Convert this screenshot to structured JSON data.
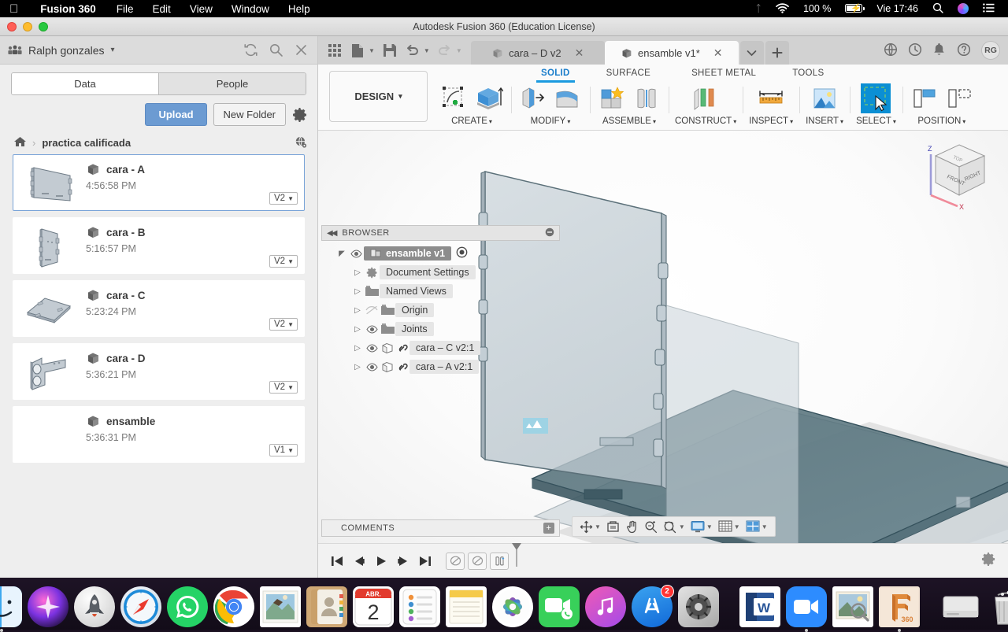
{
  "macos": {
    "apple_icon": "apple-logo-icon",
    "app_name": "Fusion 360",
    "menus": [
      "File",
      "Edit",
      "View",
      "Window",
      "Help"
    ],
    "status": {
      "bluetooth_icon": "bluetooth-icon",
      "wifi_icon": "wifi-icon",
      "battery_percent": "100 %",
      "battery_icon": "battery-charging-icon",
      "clock": "Vie 17:46",
      "search_icon": "spotlight-search-icon",
      "siri_icon": "siri-icon",
      "control_center_icon": "notification-center-icon"
    }
  },
  "window": {
    "title": "Autodesk Fusion 360 (Education License)"
  },
  "data_panel": {
    "user_name": "Ralph gonzales",
    "user_caret": "▾",
    "icons": {
      "people_group": "people-group-icon",
      "refresh": "refresh-icon",
      "search": "search-icon",
      "close": "close-icon",
      "settings_gear": "gear-icon",
      "globe": "globe-share-icon",
      "home": "home-icon"
    },
    "tabs": [
      {
        "label": "Data",
        "active": true
      },
      {
        "label": "People",
        "active": false
      }
    ],
    "upload_label": "Upload",
    "new_folder_label": "New Folder",
    "breadcrumb": {
      "home": "home-icon",
      "separator": "›",
      "folder": "practica calificada"
    },
    "files": [
      {
        "name": "cara - A",
        "time": "4:56:58 PM",
        "version": "V2",
        "selected": true,
        "thumb": "panel-a"
      },
      {
        "name": "cara - B",
        "time": "5:16:57 PM",
        "version": "V2",
        "selected": false,
        "thumb": "panel-b"
      },
      {
        "name": "cara - C",
        "time": "5:23:24 PM",
        "version": "V2",
        "selected": false,
        "thumb": "panel-c"
      },
      {
        "name": "cara - D",
        "time": "5:36:21 PM",
        "version": "V2",
        "selected": false,
        "thumb": "panel-d"
      },
      {
        "name": "ensamble",
        "time": "5:36:31 PM",
        "version": "V1",
        "selected": false,
        "thumb": "none"
      }
    ]
  },
  "quick_access": {
    "icons": [
      "grid-apps-icon",
      "new-file-icon",
      "save-icon",
      "undo-icon",
      "redo-icon"
    ]
  },
  "document_tabs": [
    {
      "label": "cara – D v2",
      "active": false,
      "close": "✕"
    },
    {
      "label": "ensamble v1*",
      "active": true,
      "close": "✕"
    }
  ],
  "tab_buttons": {
    "dropdown": "chevron-down-icon",
    "add": "+"
  },
  "header_right": {
    "icons": [
      "globe-icon",
      "job-status-icon",
      "notifications-bell-icon",
      "help-question-icon"
    ],
    "avatar_initials": "RG"
  },
  "ribbon": {
    "workspace": "DESIGN",
    "workspace_caret": "▾",
    "tabs": [
      {
        "label": "SOLID",
        "active": true
      },
      {
        "label": "SURFACE",
        "active": false
      },
      {
        "label": "SHEET METAL",
        "active": false
      },
      {
        "label": "TOOLS",
        "active": false
      }
    ],
    "panels": [
      {
        "label": "CREATE",
        "caret": "▾",
        "icons": [
          "create-sketch-icon",
          "extrude-icon"
        ]
      },
      {
        "label": "MODIFY",
        "caret": "▾",
        "icons": [
          "press-pull-icon",
          "fillet-icon"
        ]
      },
      {
        "label": "ASSEMBLE",
        "caret": "▾",
        "icons": [
          "new-component-icon",
          "joint-icon"
        ]
      },
      {
        "label": "CONSTRUCT",
        "caret": "▾",
        "icons": [
          "offset-plane-icon"
        ]
      },
      {
        "label": "INSPECT",
        "caret": "▾",
        "icons": [
          "measure-icon"
        ]
      },
      {
        "label": "INSERT",
        "caret": "▾",
        "icons": [
          "insert-image-icon"
        ]
      },
      {
        "label": "SELECT",
        "caret": "▾",
        "icons": [
          "select-window-icon"
        ],
        "active": true
      },
      {
        "label": "POSITION",
        "caret": "▾",
        "icons": [
          "align-icon",
          "move-copy-icon"
        ]
      }
    ]
  },
  "browser": {
    "title": "BROWSER",
    "collapse_icon": "collapse-left-icon",
    "minimize_icon": "minimize-icon",
    "nodes": [
      {
        "label": "ensamble v1",
        "indent": 0,
        "eye": true,
        "kind": "assembly",
        "root": true
      },
      {
        "label": "Document Settings",
        "indent": 1,
        "eye": false,
        "kind": "gear"
      },
      {
        "label": "Named Views",
        "indent": 1,
        "eye": false,
        "kind": "folder"
      },
      {
        "label": "Origin",
        "indent": 1,
        "eye": "off",
        "kind": "folder"
      },
      {
        "label": "Joints",
        "indent": 1,
        "eye": true,
        "kind": "folder"
      },
      {
        "label": "cara – C v2:1",
        "indent": 1,
        "eye": true,
        "kind": "component-linked"
      },
      {
        "label": "cara – A v2:1",
        "indent": 1,
        "eye": true,
        "kind": "component-linked"
      }
    ]
  },
  "viewcube": {
    "faces": [
      "FRONT",
      "RIGHT",
      "TOP"
    ],
    "axes": {
      "z": "Z",
      "x": "X"
    }
  },
  "nav_bar": {
    "icons": [
      "orbit-icon",
      "look-at-icon",
      "pan-icon",
      "zoom-icon",
      "zoom-window-icon",
      "display-settings-icon",
      "grid-snap-icon",
      "viewports-icon"
    ]
  },
  "comments": {
    "label": "COMMENTS",
    "add_icon": "add-comment-icon"
  },
  "timeline": {
    "buttons": [
      "skip-start-icon",
      "step-back-icon",
      "play-icon",
      "step-forward-icon",
      "skip-end-icon"
    ],
    "features": [
      "joint-feature-icon",
      "joint-feature-icon",
      "joint-origin-icon"
    ],
    "settings_icon": "gear-icon"
  },
  "dock": {
    "items": [
      {
        "name": "Finder",
        "icon": "finder-icon",
        "running": true,
        "badge": null
      },
      {
        "name": "Siri",
        "icon": "siri-icon",
        "running": false,
        "badge": null
      },
      {
        "name": "Launchpad",
        "icon": "launchpad-icon",
        "running": false,
        "badge": null
      },
      {
        "name": "Safari",
        "icon": "safari-icon",
        "running": false,
        "badge": null
      },
      {
        "name": "WhatsApp",
        "icon": "whatsapp-icon",
        "running": true,
        "badge": null
      },
      {
        "name": "Google Chrome",
        "icon": "chrome-icon",
        "running": false,
        "badge": null
      },
      {
        "name": "Mail",
        "icon": "mail-stamp-icon",
        "running": false,
        "badge": null
      },
      {
        "name": "Contacts",
        "icon": "contacts-icon",
        "running": false,
        "badge": null
      },
      {
        "name": "Calendar",
        "icon": "calendar-icon",
        "running": false,
        "badge": null,
        "month": "ABR.",
        "day": "2"
      },
      {
        "name": "Reminders",
        "icon": "reminders-icon",
        "running": false,
        "badge": null
      },
      {
        "name": "Notes",
        "icon": "notes-icon",
        "running": false,
        "badge": null
      },
      {
        "name": "Photos",
        "icon": "photos-icon",
        "running": false,
        "badge": null
      },
      {
        "name": "FaceTime",
        "icon": "facetime-icon",
        "running": false,
        "badge": null
      },
      {
        "name": "iTunes",
        "icon": "itunes-icon",
        "running": false,
        "badge": null
      },
      {
        "name": "App Store",
        "icon": "app-store-icon",
        "running": false,
        "badge": "2"
      },
      {
        "name": "System Preferences",
        "icon": "system-prefs-icon",
        "running": false,
        "badge": null
      },
      {
        "name": "Microsoft Word",
        "icon": "word-icon",
        "running": false,
        "badge": null
      },
      {
        "name": "Zoom",
        "icon": "zoom-app-icon",
        "running": true,
        "badge": null
      },
      {
        "name": "Preview",
        "icon": "preview-icon",
        "running": false,
        "badge": null
      },
      {
        "name": "Fusion 360",
        "icon": "fusion360-icon",
        "running": true,
        "badge": null
      },
      {
        "name": "Disk",
        "icon": "external-disk-icon",
        "running": false,
        "badge": null
      },
      {
        "name": "Trash",
        "icon": "trash-icon",
        "running": false,
        "badge": null
      }
    ]
  }
}
